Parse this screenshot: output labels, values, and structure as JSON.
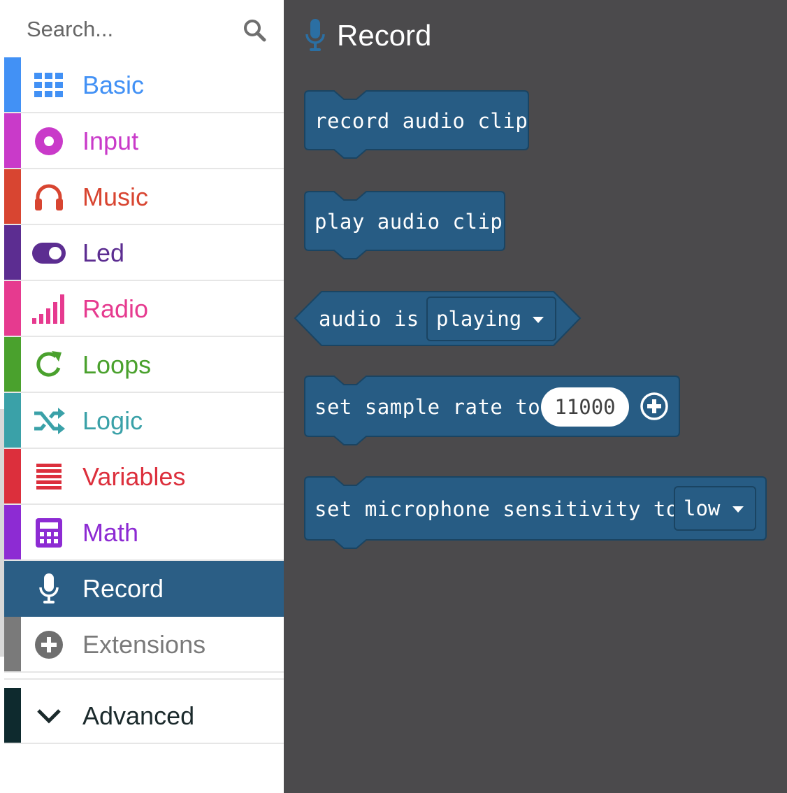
{
  "search": {
    "placeholder": "Search..."
  },
  "categories": [
    {
      "label": "Basic",
      "color": "#4291f5",
      "icon": "grid-icon"
    },
    {
      "label": "Input",
      "color": "#c93ac9",
      "icon": "target-icon"
    },
    {
      "label": "Music",
      "color": "#d84531",
      "icon": "headphones-icon"
    },
    {
      "label": "Led",
      "color": "#5c2d91",
      "icon": "toggle-icon"
    },
    {
      "label": "Radio",
      "color": "#e63a8f",
      "icon": "signal-bars-icon"
    },
    {
      "label": "Loops",
      "color": "#4aa12d",
      "icon": "refresh-icon"
    },
    {
      "label": "Logic",
      "color": "#3aa1a8",
      "icon": "shuffle-icon"
    },
    {
      "label": "Variables",
      "color": "#dc2f3c",
      "icon": "list-lines-icon"
    },
    {
      "label": "Math",
      "color": "#8d2bd3",
      "icon": "calculator-icon"
    },
    {
      "label": "Record",
      "color": "#2b5e85",
      "icon": "microphone-icon",
      "selected": true
    },
    {
      "label": "Extensions",
      "color": "#7a7a7a",
      "icon": "plus-circle-icon"
    }
  ],
  "advanced": {
    "label": "Advanced",
    "color": "#0e2a2e",
    "icon": "chevron-down-icon"
  },
  "flyout": {
    "title": "Record",
    "icon": "microphone-icon",
    "block_color": "#275c84",
    "blocks": {
      "record": "record audio clip",
      "play": "play audio clip",
      "is_playing": {
        "prefix": "audio is",
        "dropdown": "playing"
      },
      "sample_rate": {
        "text": "set sample rate to",
        "value": "11000"
      },
      "sensitivity": {
        "text": "set microphone sensitivity to",
        "dropdown": "low"
      }
    }
  }
}
